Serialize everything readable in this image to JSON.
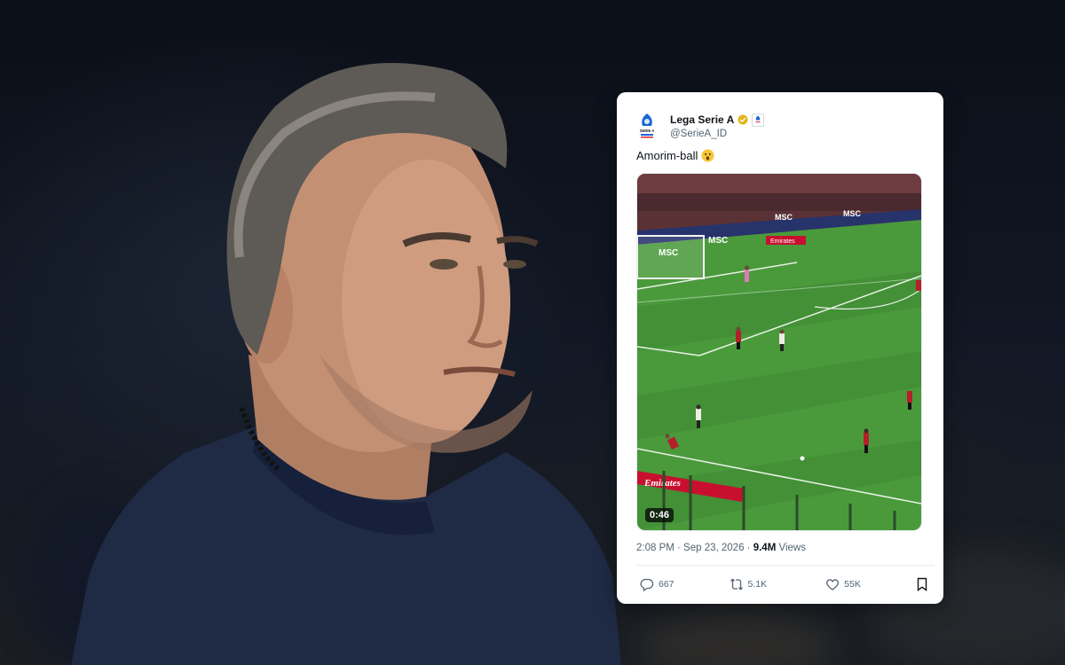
{
  "tweet": {
    "display_name": "Lega Serie A",
    "handle": "@SerieA_ID",
    "verified_badge_color": "#e2b719",
    "text": "Amorim-ball",
    "emoji": "astonished-face",
    "logo_label": "SERIE A",
    "video": {
      "duration": "0:46",
      "ad_boards": [
        "MSC",
        "MSC",
        "MSC",
        "MSC",
        "Emirates",
        "Emirates"
      ]
    },
    "timestamp": "2:08 PM · Sep 23, 2026 · ",
    "views_count": "9.4M",
    "views_label": " Views",
    "replies": "667",
    "reposts": "5.1K",
    "likes": "55K"
  },
  "colors": {
    "pitch": "#4a9a3c",
    "pitch_dark": "#3f8a33",
    "text_secondary": "#536471"
  }
}
